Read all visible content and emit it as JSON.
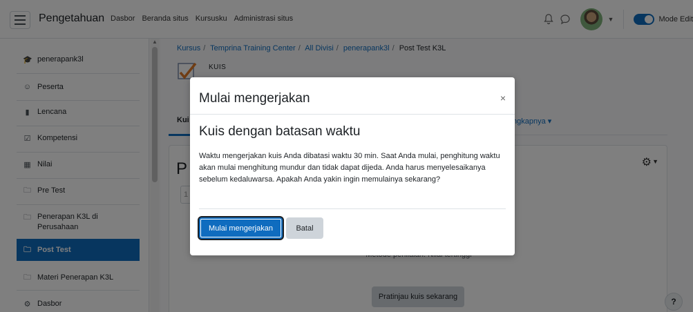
{
  "navbar": {
    "brand": "Pengetahuan",
    "links": [
      "Dasbor",
      "Beranda situs",
      "Kursusku",
      "Administrasi situs"
    ],
    "edit_mode_label": "Mode Edit",
    "edit_mode_on": true
  },
  "drawer": {
    "items": [
      {
        "label": "penerapank3l",
        "icon": "graduation-cap-icon"
      },
      {
        "label": "Peserta",
        "icon": "users-icon"
      },
      {
        "label": "Lencana",
        "icon": "shield-icon"
      },
      {
        "label": "Kompetensi",
        "icon": "checkbox-icon"
      },
      {
        "label": "Nilai",
        "icon": "table-icon"
      },
      {
        "label": "Pre Test",
        "icon": "folder-icon"
      },
      {
        "label": "Penerapan K3L di Perusahaan",
        "icon": "folder-icon"
      },
      {
        "label": "Post Test",
        "icon": "folder-icon",
        "active": true
      },
      {
        "label": "Materi Penerapan K3L",
        "icon": "folder-icon"
      },
      {
        "label": "Dasbor",
        "icon": "tachometer-icon"
      }
    ]
  },
  "breadcrumb": {
    "items": [
      "Kursus",
      "Temprina Training Center",
      "All Divisi",
      "penerapank3l"
    ],
    "current": "Post Test K3L"
  },
  "page": {
    "module_type": "KUIS",
    "tab_active": "Kui",
    "tab_more": "ngkapnya ▾",
    "title_partial": "P",
    "field_partial": "1",
    "grading_text": "Metode penilaian: Nilai tertinggi",
    "preview_button": "Pratinjau kuis sekarang",
    "help_button": "?"
  },
  "modal": {
    "title": "Mulai mengerjakan",
    "close": "×",
    "subtitle": "Kuis dengan batasan waktu",
    "text": "Waktu mengerjakan kuis Anda dibatasi waktu 30 min. Saat Anda mulai, penghitung waktu akan mulai menghitung mundur dan tidak dapat dijeda. Anda harus menyelesaikanya sebelum kedaluwarsa. Apakah Anda yakin ingin memulainya sekarang?",
    "primary_button": "Mulai mengerjakan",
    "secondary_button": "Batal"
  },
  "colors": {
    "primary": "#0f6cbf",
    "backdrop": "rgba(0,0,0,0.5)"
  }
}
